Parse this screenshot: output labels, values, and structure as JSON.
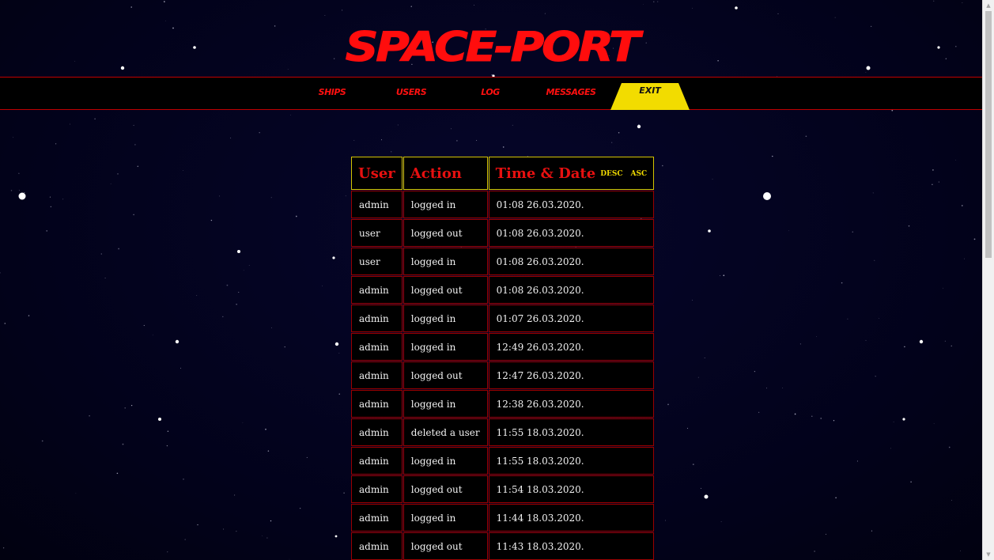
{
  "logo": {
    "text": "SPACE-PORT"
  },
  "nav": {
    "ships": "SHIPS",
    "users": "USERS",
    "log": "LOG",
    "messages": "MESSAGES",
    "exit": "EXIT"
  },
  "table": {
    "headers": {
      "user": "User",
      "action": "Action",
      "time": "Time & Date",
      "desc": "DESC",
      "asc": "ASC"
    },
    "rows": [
      {
        "user": "admin",
        "action": "logged in",
        "time": "01:08 26.03.2020."
      },
      {
        "user": "user",
        "action": "logged out",
        "time": "01:08 26.03.2020."
      },
      {
        "user": "user",
        "action": "logged in",
        "time": "01:08 26.03.2020."
      },
      {
        "user": "admin",
        "action": "logged out",
        "time": "01:08 26.03.2020."
      },
      {
        "user": "admin",
        "action": "logged in",
        "time": "01:07 26.03.2020."
      },
      {
        "user": "admin",
        "action": "logged in",
        "time": "12:49 26.03.2020."
      },
      {
        "user": "admin",
        "action": "logged out",
        "time": "12:47 26.03.2020."
      },
      {
        "user": "admin",
        "action": "logged in",
        "time": "12:38 26.03.2020."
      },
      {
        "user": "admin",
        "action": "deleted a user",
        "time": "11:55 18.03.2020."
      },
      {
        "user": "admin",
        "action": "logged in",
        "time": "11:55 18.03.2020."
      },
      {
        "user": "admin",
        "action": "logged out",
        "time": "11:54 18.03.2020."
      },
      {
        "user": "admin",
        "action": "logged in",
        "time": "11:44 18.03.2020."
      },
      {
        "user": "admin",
        "action": "logged out",
        "time": "11:43 18.03.2020."
      }
    ]
  },
  "colors": {
    "background": "#03031a",
    "accent_red": "#ff0d0d",
    "accent_yellow": "#f2dc00"
  }
}
